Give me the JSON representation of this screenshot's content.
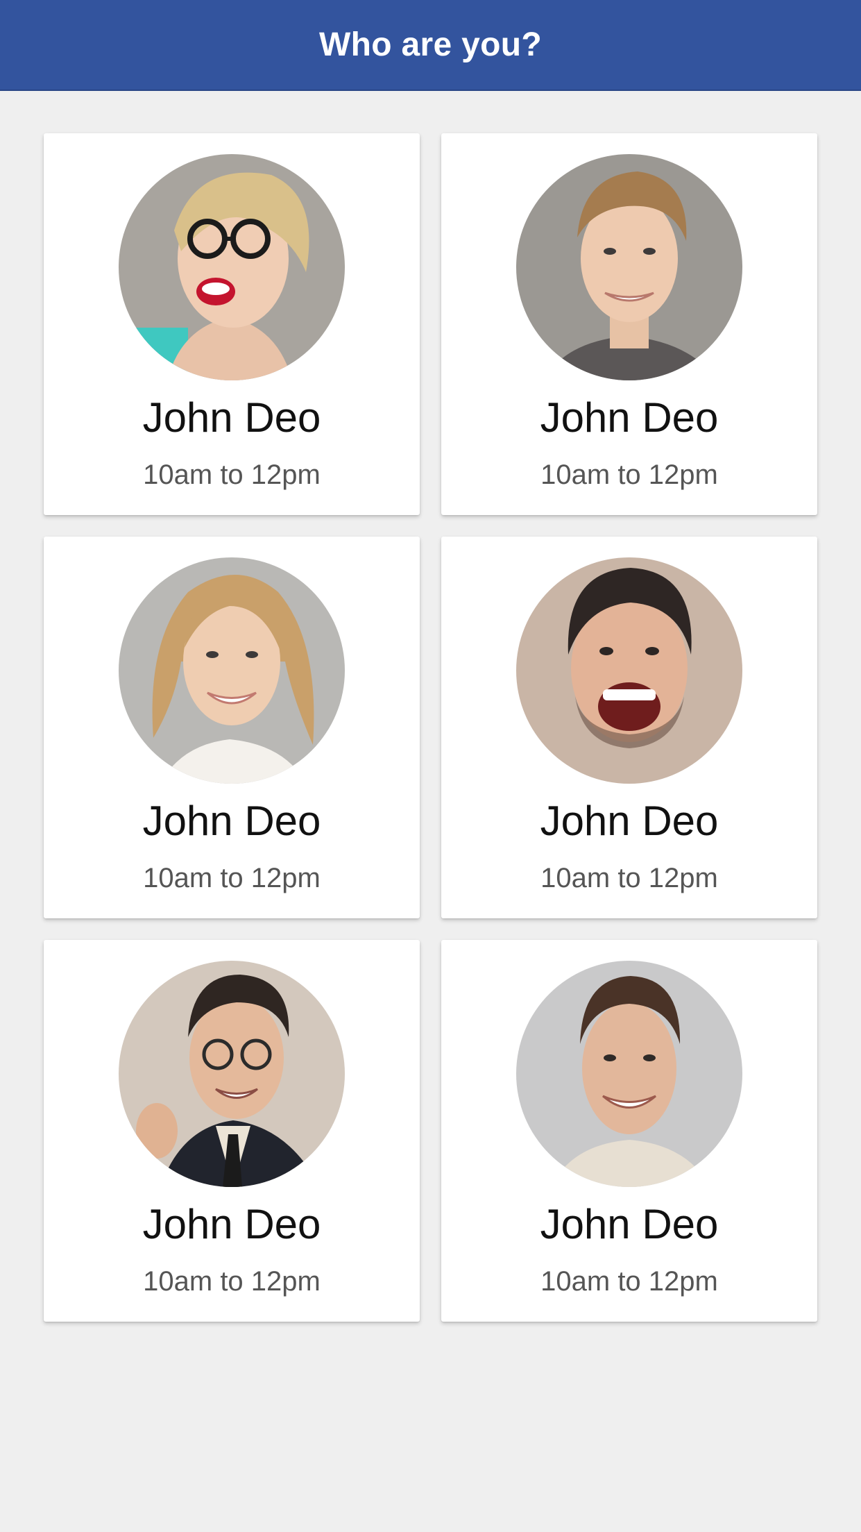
{
  "header": {
    "title": "Who are you?",
    "background_color": "#33549e"
  },
  "people": [
    {
      "name": "John Deo",
      "time": "10am to 12pm",
      "avatar": "woman-with-glasses-photo"
    },
    {
      "name": "John Deo",
      "time": "10am to 12pm",
      "avatar": "young-man-photo"
    },
    {
      "name": "John Deo",
      "time": "10am to 12pm",
      "avatar": "blonde-woman-photo"
    },
    {
      "name": "John Deo",
      "time": "10am to 12pm",
      "avatar": "laughing-man-photo"
    },
    {
      "name": "John Deo",
      "time": "10am to 12pm",
      "avatar": "man-with-glasses-thumbs-up-photo"
    },
    {
      "name": "John Deo",
      "time": "10am to 12pm",
      "avatar": "smiling-man-photo"
    }
  ]
}
